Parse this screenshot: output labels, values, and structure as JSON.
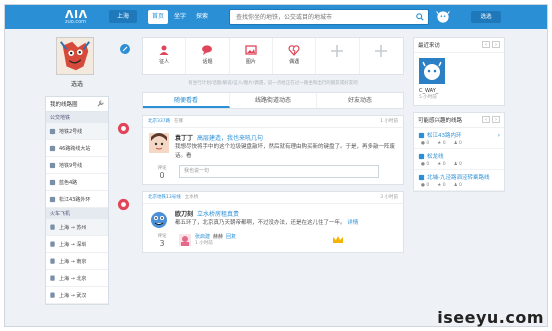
{
  "header": {
    "logo": "ΛIΛ",
    "logo_domain": "zuo.com",
    "city": "上海",
    "nav": [
      "首页",
      "坐字",
      "探索"
    ],
    "search_placeholder": "查找你坐的地铁，公交或目的地城市",
    "login": "选选",
    "brand_color": "#2b8fd6"
  },
  "left": {
    "username": "选选",
    "my_lines_title": "我的线路圈",
    "sections": {
      "bus": "公交地铁",
      "train": "火车飞机"
    },
    "bus_items": [
      "地铁2号线",
      "46路跨线大站",
      "地铁9号线",
      "蓝色4路",
      "松江43路外环"
    ],
    "train_items": [
      "上海 → 苏州",
      "上海 → 深圳",
      "上海 → 南京",
      "上海 → 北京",
      "上海 → 武汉"
    ]
  },
  "center": {
    "share_types": [
      "征人",
      "话题",
      "图片",
      "偶遇",
      "",
      ""
    ],
    "hint": "有坐行计划/话题/解说/征人/图片/偶遇，说一点给正在过一路坐和出行的朋友或好友吧",
    "tabs": [
      "随便看看",
      "线路街道动态",
      "好友动态"
    ],
    "posts": [
      {
        "route": "北京337路",
        "route_sub": "在哪",
        "time": "1 小时前",
        "author": "袁丁丁",
        "author_tag": "高层建造，我也来吼几句",
        "text": "我想尽快将手中的这个垃圾键盘敲坏，然后就有理由购买新的键盘了。于是，再多敲一阵废话。看",
        "comment_label": "评论",
        "comment_count": "0",
        "comment_placeholder": "我也说一句"
      },
      {
        "route": "北京地铁13号线",
        "route_sub": "立水桥",
        "time": "3 小时前",
        "author": "欧刀刻",
        "author_tag": "立水桥房租真贵",
        "text": "都五环了，北京真乃天朝帝都啊，不过没办法，还是在这儿住了一年。",
        "text_link": "详情",
        "comment_label": "评论",
        "comment_count": "3",
        "reply_name": "张启建",
        "reply_body": "赫赫",
        "reply_action": "回复",
        "reply_time": "1 小时前"
      }
    ]
  },
  "right": {
    "recent_title": "最近来访",
    "visitor_name": "C_WAY_",
    "visitor_time": "5 小时前",
    "lines_title": "可能感兴趣的线路",
    "lines": [
      {
        "name": "松江43路内环",
        "a": "0",
        "b": "0",
        "c": "0"
      },
      {
        "name": "松龙线",
        "a": "0",
        "b": "0",
        "c": "0"
      },
      {
        "name": "北埔-九泾路泗泾转乘路线",
        "a": "0",
        "b": "0",
        "c": "0"
      }
    ]
  },
  "watermark": "iseeyu.com"
}
